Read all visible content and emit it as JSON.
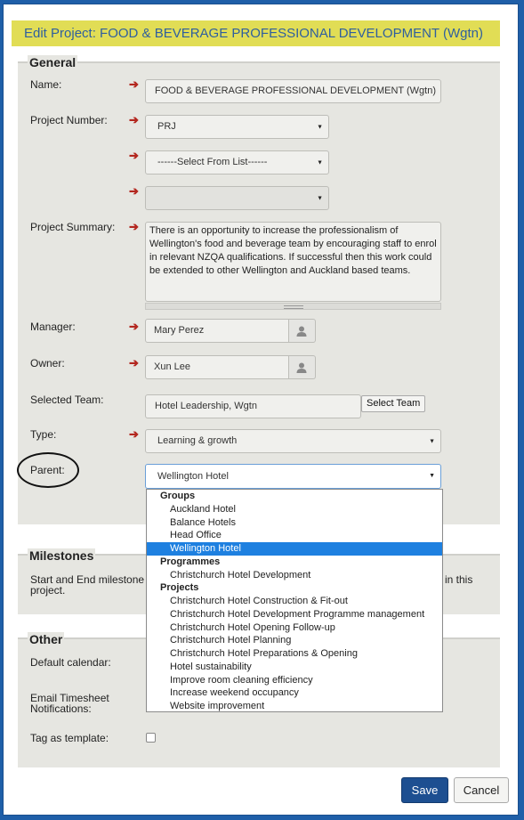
{
  "dialog": {
    "title": "Edit Project: FOOD & BEVERAGE PROFESSIONAL DEVELOPMENT (Wgtn)"
  },
  "general": {
    "legend": "General",
    "name_label": "Name:",
    "name_value": "FOOD & BEVERAGE PROFESSIONAL DEVELOPMENT (Wgtn)",
    "project_number_label": "Project Number:",
    "project_number_value": "PRJ",
    "select_list_value": "------Select From List------",
    "third_select_value": "",
    "summary_label": "Project Summary:",
    "summary_value": "There is an opportunity to increase the professionalism of Wellington's food and beverage team by encouraging staff to enrol in relevant NZQA qualifications. If successful then this work could be extended to other Wellington and Auckland based teams.",
    "manager_label": "Manager:",
    "manager_value": "Mary Perez",
    "owner_label": "Owner:",
    "owner_value": "Xun Lee",
    "team_label": "Selected Team:",
    "team_value": "Hotel Leadership, Wgtn",
    "select_team_button": "Select Team",
    "type_label": "Type:",
    "type_value": "Learning & growth",
    "parent_label": "Parent:",
    "parent_value": "Wellington Hotel"
  },
  "parent_dropdown": {
    "groups_label": "Groups",
    "groups": [
      "Auckland Hotel",
      "Balance Hotels",
      "Head Office",
      "Wellington Hotel"
    ],
    "programmes_label": "Programmes",
    "programmes": [
      "Christchurch Hotel Development"
    ],
    "projects_label": "Projects",
    "projects": [
      "Christchurch Hotel Construction & Fit-out",
      "Christchurch Hotel Development Programme management",
      "Christchurch Hotel Opening Follow-up",
      "Christchurch Hotel Planning",
      "Christchurch Hotel Preparations & Opening",
      "Hotel sustainability",
      "Improve room cleaning efficiency",
      "Increase weekend occupancy",
      "Website improvement"
    ],
    "selected": "Wellington Hotel"
  },
  "milestones": {
    "legend": "Milestones",
    "text_left": "Start and End milestone",
    "text_right": "in this",
    "text_line2": "project."
  },
  "other": {
    "legend": "Other",
    "calendar_label": "Default calendar:",
    "email_label_line1": "Email Timesheet",
    "email_label_line2": "Notifications:",
    "template_label": "Tag as template:"
  },
  "footer": {
    "save_label": "Save",
    "cancel_label": "Cancel"
  },
  "icons": {
    "required": "arrow-right-icon",
    "person": "person-icon",
    "caret": "caret-down-icon"
  },
  "colors": {
    "title_bg": "#e1dd55",
    "title_text": "#2f5f9e",
    "save_bg": "#1d4f91",
    "selected_option": "#1e80e0",
    "required_arrow": "#b3261e"
  }
}
